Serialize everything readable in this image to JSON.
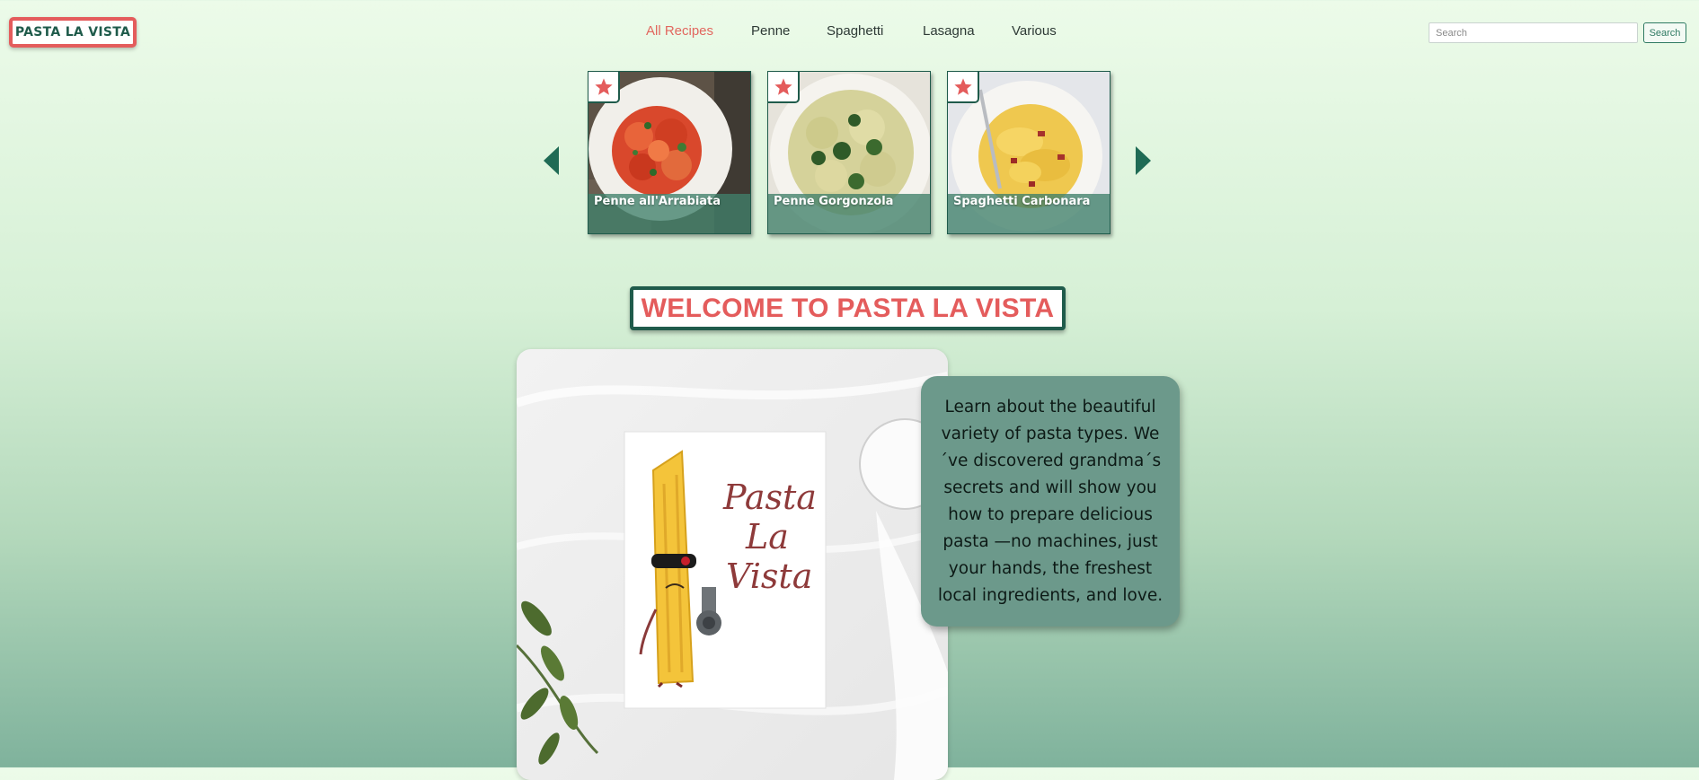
{
  "brand": {
    "label": "PASTA LA VISTA"
  },
  "nav": {
    "links": [
      {
        "label": "All Recipes",
        "active": true
      },
      {
        "label": "Penne"
      },
      {
        "label": "Spaghetti"
      },
      {
        "label": "Lasagna"
      },
      {
        "label": "Various"
      }
    ]
  },
  "search": {
    "placeholder": "Search",
    "button_label": "Search"
  },
  "carousel": {
    "cards": [
      {
        "title": "Penne all'Arrabiata",
        "icon": "star-icon"
      },
      {
        "title": "Penne Gorgonzola",
        "icon": "star-icon"
      },
      {
        "title": "Spaghetti Carbonara",
        "icon": "star-icon"
      }
    ]
  },
  "welcome": {
    "heading": "WELCOME TO PASTA LA VISTA"
  },
  "hero_card": {
    "text": [
      "Pasta",
      "La",
      "Vista"
    ]
  },
  "intro": {
    "text": "Learn about the beautiful variety of pasta types. We´ve discovered grandma´s secrets and will show you how to prepare delicious pasta —no machines, just your hands, the freshest local ingredients, and love."
  },
  "colors": {
    "accent_red": "#e45c5c",
    "brand_green": "#1f5b4b",
    "panel_green": "#6c998b"
  }
}
